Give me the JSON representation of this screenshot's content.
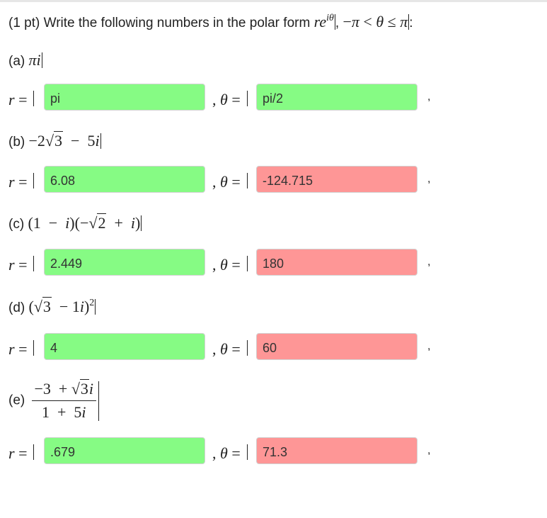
{
  "header": {
    "points": "(1 pt)",
    "prompt": "Write the following numbers in the polar form",
    "form_expr": "re^{iθ}",
    "range_expr": "−π < θ ≤ π"
  },
  "questions": [
    {
      "label": "(a)",
      "expr": "πi",
      "r_value": "pi",
      "theta_value": "pi/2",
      "r_status": "correct",
      "theta_status": "correct"
    },
    {
      "label": "(b)",
      "expr": "−2√3 − 5i",
      "r_value": "6.08",
      "theta_value": "-124.715",
      "r_status": "correct",
      "theta_status": "incorrect"
    },
    {
      "label": "(c)",
      "expr": "(1 − i)(−√2 + i)",
      "r_value": "2.449",
      "theta_value": "180",
      "r_status": "correct",
      "theta_status": "incorrect"
    },
    {
      "label": "(d)",
      "expr": "(√3 − 1i)^2",
      "r_value": "4",
      "theta_value": "60",
      "r_status": "correct",
      "theta_status": "incorrect"
    },
    {
      "label": "(e)",
      "expr": "(−3 + √3i)/(1 + 5i)",
      "r_value": ".679",
      "theta_value": "71.3",
      "r_status": "correct",
      "theta_status": "incorrect"
    }
  ],
  "labels": {
    "r": "r",
    "eq": "=",
    "comma": ",",
    "theta": "θ",
    "trail": ","
  },
  "colors": {
    "correct": "#86fb84",
    "incorrect": "#fe9696"
  }
}
